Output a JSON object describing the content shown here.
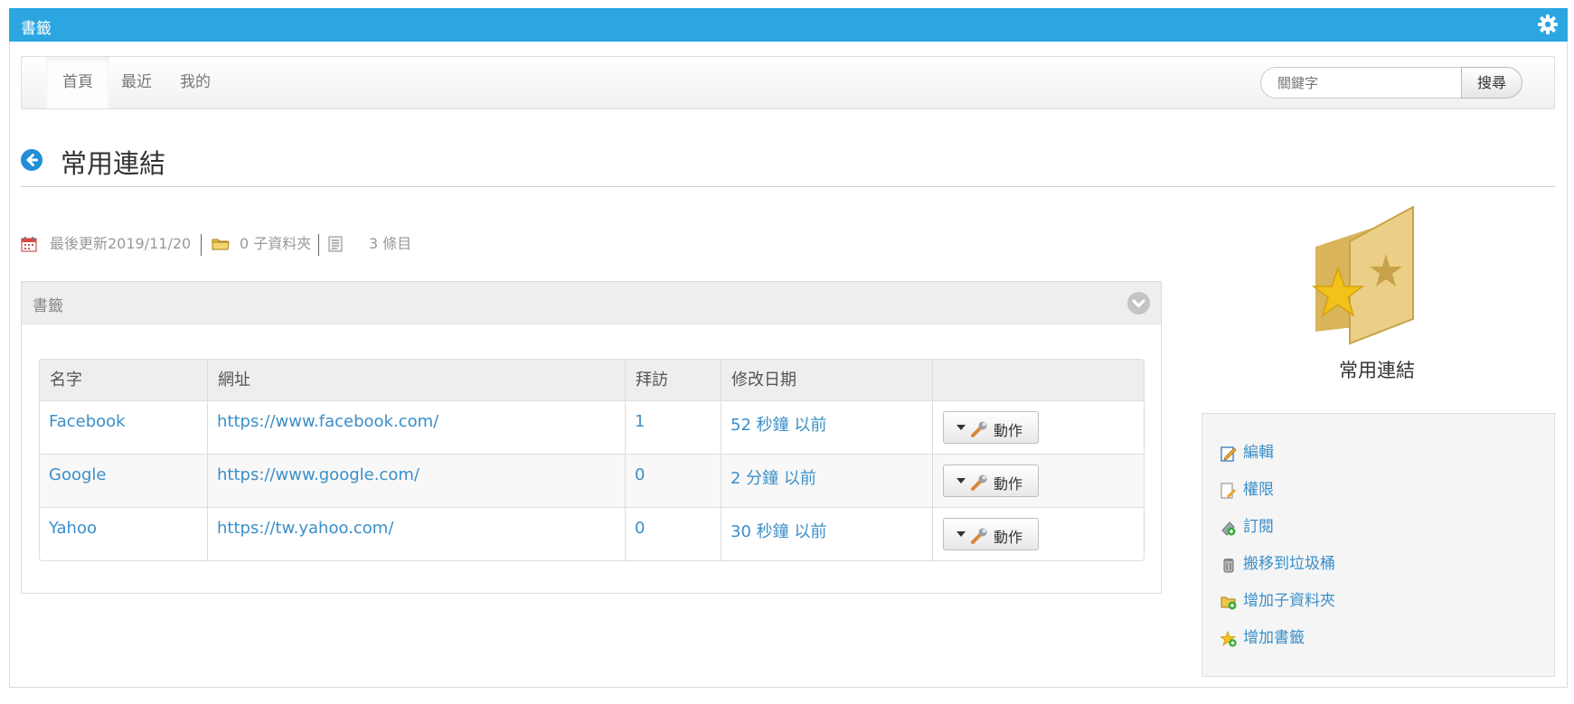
{
  "topbar": {
    "title": "書籤",
    "settings_icon": "gear-icon"
  },
  "nav": {
    "tabs": [
      {
        "label": "首頁",
        "active": true
      },
      {
        "label": "最近",
        "active": false
      },
      {
        "label": "我的",
        "active": false
      }
    ]
  },
  "search": {
    "placeholder": "關鍵字",
    "button_label": "搜尋"
  },
  "page": {
    "title": "常用連結",
    "back_icon": "arrow-left-circle-icon"
  },
  "meta": {
    "updated": "最後更新2019/11/20",
    "folders": "0 子資料夾",
    "items": "3 條目"
  },
  "panel": {
    "title": "書籤"
  },
  "table": {
    "headers": [
      "名字",
      "網址",
      "拜訪",
      "修改日期",
      ""
    ],
    "rows": [
      {
        "name": "Facebook",
        "url": "https://www.facebook.com/",
        "visits": "1",
        "modified": "52 秒鐘 以前",
        "action": "動作"
      },
      {
        "name": "Google",
        "url": "https://www.google.com/",
        "visits": "0",
        "modified": "2 分鐘 以前",
        "action": "動作"
      },
      {
        "name": "Yahoo",
        "url": "https://tw.yahoo.com/",
        "visits": "0",
        "modified": "30 秒鐘 以前",
        "action": "動作"
      }
    ]
  },
  "sidebar": {
    "title": "常用連結",
    "actions": [
      "編輯",
      "權限",
      "訂閱",
      "搬移到垃圾桶",
      "增加子資料夾",
      "增加書籤"
    ]
  },
  "colors": {
    "accent": "#2ba6e1",
    "link": "#3a8fc9"
  }
}
